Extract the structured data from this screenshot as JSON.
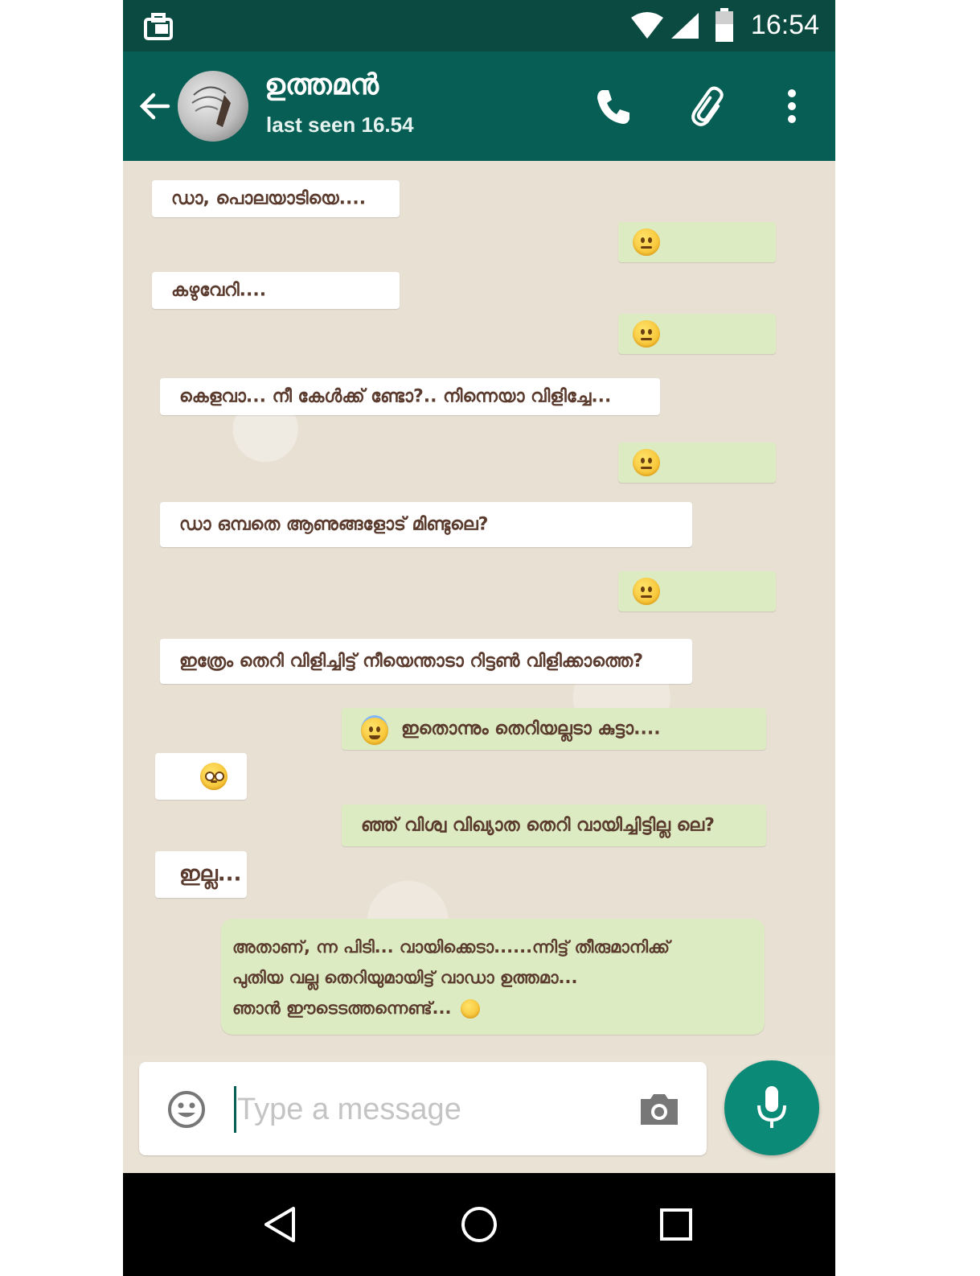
{
  "status_bar": {
    "time": "16:54"
  },
  "header": {
    "contact_name": "ഉത്തമൻ",
    "last_seen": "last seen 16.54"
  },
  "messages": [
    {
      "dir": "in",
      "text": "ഡാ, പൊലയാടിയെ...."
    },
    {
      "dir": "out",
      "emoji": "neutral-face"
    },
    {
      "dir": "in",
      "text": "കഴുവേറി...."
    },
    {
      "dir": "out",
      "emoji": "neutral-face"
    },
    {
      "dir": "in",
      "text": "കെളവാ... നീ കേൾക്ക് ണ്ടോ?.. നിന്നെയാ വിളിച്ചേ..."
    },
    {
      "dir": "out",
      "emoji": "neutral-face"
    },
    {
      "dir": "in",
      "text": "ഡാ ഒമ്പതെ ആണുങ്ങളോട് മിണ്ടുലെ?"
    },
    {
      "dir": "out",
      "emoji": "neutral-face"
    },
    {
      "dir": "in",
      "text": "ഇത്രേം തെറി വിളിച്ചിട്ട് നീയെന്താടാ റിട്ടൺ വിളിക്കാത്തെ?"
    },
    {
      "dir": "out",
      "emoji": "halo-face",
      "text": "ഇതൊന്നും തെറിയല്ലടാ കുട്ടാ...."
    },
    {
      "dir": "in",
      "emoji": "flushed-face"
    },
    {
      "dir": "out",
      "text": "ഞ്ഞ് വിശ്വ വിഖ്യാത തെറി വായിച്ചിട്ടില്ല ലെ?"
    },
    {
      "dir": "in",
      "text": "ഇല്ല..."
    },
    {
      "dir": "out",
      "lines": [
        "അതാണ്, ന്ന പിടി... വായിക്കെടാ......ന്നിട്ട് തീരുമാനിക്ക്",
        "പുതിയ വല്ല തെറിയുമായിട്ട് വാഡാ ഉത്തമാ...",
        "ഞാൻ ഈടെടത്തന്നെണ്ട്..."
      ],
      "emoji": "smirk-face"
    }
  ],
  "input": {
    "placeholder": "Type a message"
  },
  "icons": {
    "status_left": "briefcase-icon",
    "wifi": "wifi-icon",
    "signal": "signal-icon",
    "battery": "battery-icon",
    "back": "back-arrow-icon",
    "call": "phone-icon",
    "attach": "paperclip-icon",
    "menu": "more-vert-icon",
    "emoji_button": "emoji-icon",
    "camera": "camera-icon",
    "mic": "mic-icon",
    "nav_back": "nav-back-icon",
    "nav_home": "nav-home-icon",
    "nav_recents": "nav-recents-icon"
  },
  "colors": {
    "header": "#075e54",
    "status_bar": "#0b4a40",
    "outgoing_bubble": "#dcebc2",
    "incoming_bubble": "#ffffff",
    "mic_button": "#0b8a78",
    "text": "#5a3b2e"
  }
}
